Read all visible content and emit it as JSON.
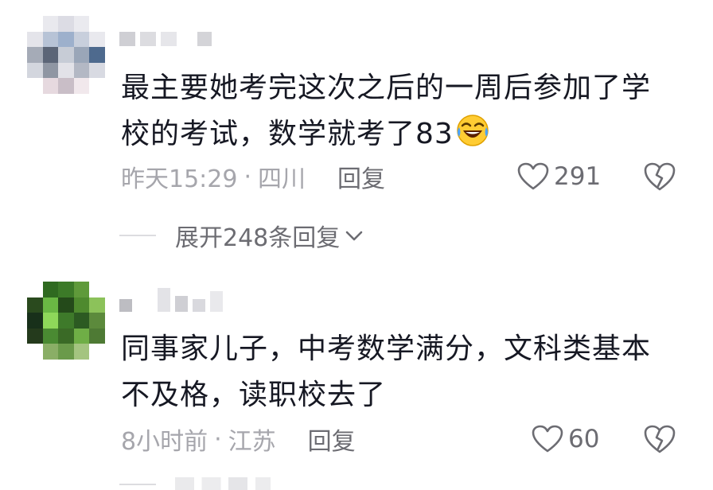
{
  "comments": [
    {
      "text_line1": "最主要她考完这次之后的一周后参加了学",
      "text_line2": "校的考试，数学就考了83",
      "time": "昨天15:29",
      "location": "四川",
      "reply_label": "回复",
      "likes": "291",
      "emoji_icon": "laughing-crying-emoji-icon",
      "expand_label": "展开248条回复"
    },
    {
      "text_line1": "同事家儿子，中考数学满分，文科类基本",
      "text_line2": "不及格，读职校去了",
      "time": "8小时前",
      "location": "江苏",
      "reply_label": "回复",
      "likes": "60"
    }
  ],
  "meta_separator": "·",
  "colors": {
    "text": "#161823",
    "meta": "#a6a6ac",
    "action": "#6c6c72",
    "line": "#dcdce0"
  }
}
